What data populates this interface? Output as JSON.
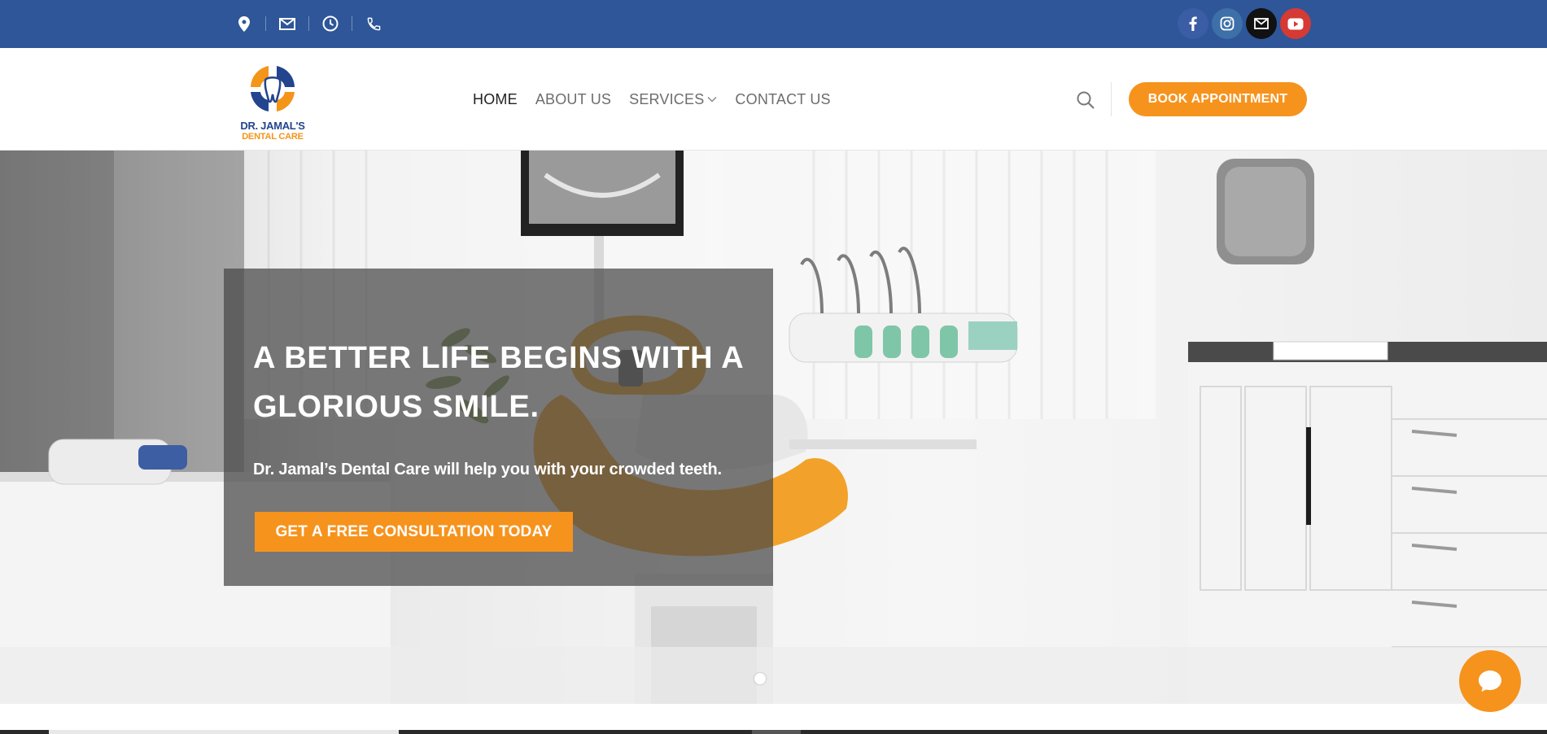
{
  "topbar": {
    "contact_icons": [
      "location-pin-icon",
      "envelope-icon",
      "clock-icon",
      "phone-icon"
    ],
    "social_icons": [
      "facebook-icon",
      "instagram-icon",
      "email-icon",
      "youtube-icon"
    ]
  },
  "header": {
    "logo_line1": "DR. JAMAL'S",
    "logo_line2": "DENTAL CARE",
    "nav": {
      "home": "HOME",
      "about": "ABOUT US",
      "services": "SERVICES",
      "contact": "CONTACT US"
    },
    "book_button": "BOOK APPOINTMENT"
  },
  "hero": {
    "headline": "A BETTER LIFE BEGINS WITH A GLORIOUS SMILE.",
    "subline": "Dr. Jamal’s Dental Care will help you with your crowded teeth.",
    "cta": "GET A FREE CONSULTATION TODAY"
  },
  "colors": {
    "topbar": "#2e5699",
    "accent": "#f6931d",
    "nav_active": "#222222",
    "nav_text": "#6d6d6d"
  }
}
